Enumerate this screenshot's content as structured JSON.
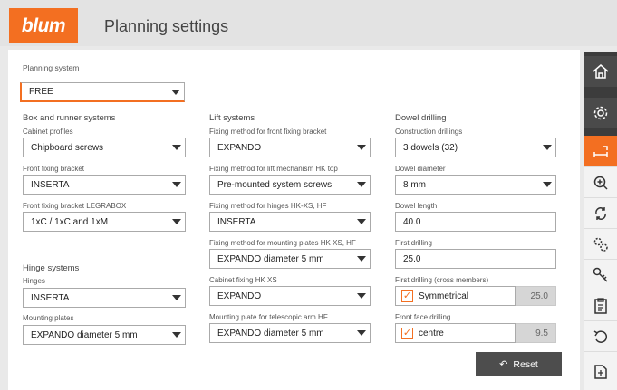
{
  "header": {
    "logo": "blum",
    "title": "Planning settings"
  },
  "planning_system": {
    "label": "Planning system",
    "value": "FREE"
  },
  "box_runner": {
    "title": "Box and runner systems",
    "cabinet_profiles": {
      "label": "Cabinet profiles",
      "value": "Chipboard screws"
    },
    "front_fixing_bracket": {
      "label": "Front fixing bracket",
      "value": "INSERTA"
    },
    "front_fixing_legrabox": {
      "label": "Front fixing bracket LEGRABOX",
      "value": "1xC / 1xC and 1xM"
    }
  },
  "hinge": {
    "title": "Hinge systems",
    "hinges": {
      "label": "Hinges",
      "value": "INSERTA"
    },
    "mounting_plates": {
      "label": "Mounting plates",
      "value": "EXPANDO diameter 5 mm"
    }
  },
  "lift": {
    "title": "Lift systems",
    "front_fixing": {
      "label": "Fixing method for front fixing bracket",
      "value": "EXPANDO"
    },
    "lift_mechanism": {
      "label": "Fixing method for lift mechanism HK top",
      "value": "Pre-mounted system screws"
    },
    "hinges_hk": {
      "label": "Fixing method for hinges HK-XS, HF",
      "value": "INSERTA"
    },
    "mounting_plates_hk": {
      "label": "Fixing method for mounting plates HK XS, HF",
      "value": "EXPANDO diameter 5 mm"
    },
    "cabinet_fixing": {
      "label": "Cabinet fixing HK XS",
      "value": "EXPANDO"
    },
    "telescopic_arm": {
      "label": "Mounting plate for telescopic arm HF",
      "value": "EXPANDO diameter 5 mm"
    }
  },
  "dowel": {
    "title": "Dowel drilling",
    "construction": {
      "label": "Construction drillings",
      "value": "3 dowels (32)"
    },
    "diameter": {
      "label": "Dowel diameter",
      "value": "8 mm"
    },
    "length": {
      "label": "Dowel length",
      "value": "40.0"
    },
    "first_drilling": {
      "label": "First drilling",
      "value": "25.0"
    },
    "cross_members": {
      "label": "First drilling (cross members)",
      "check_label": "Symmetrical",
      "checked": true,
      "value": "25.0"
    },
    "front_face": {
      "label": "Front face drilling",
      "check_label": "centre",
      "checked": true,
      "value": "9.5"
    }
  },
  "reset": {
    "label": "Reset"
  },
  "rail_icons": [
    "home-icon",
    "settings-icon",
    "dimension-icon",
    "zoom-icon",
    "rotate-icon",
    "gears-icon",
    "key-icon",
    "clipboard-icon",
    "undo-icon",
    "export-icon"
  ],
  "colors": {
    "accent": "#f36f21",
    "rail": "#3c3c3c",
    "button": "#4d4d4d"
  }
}
